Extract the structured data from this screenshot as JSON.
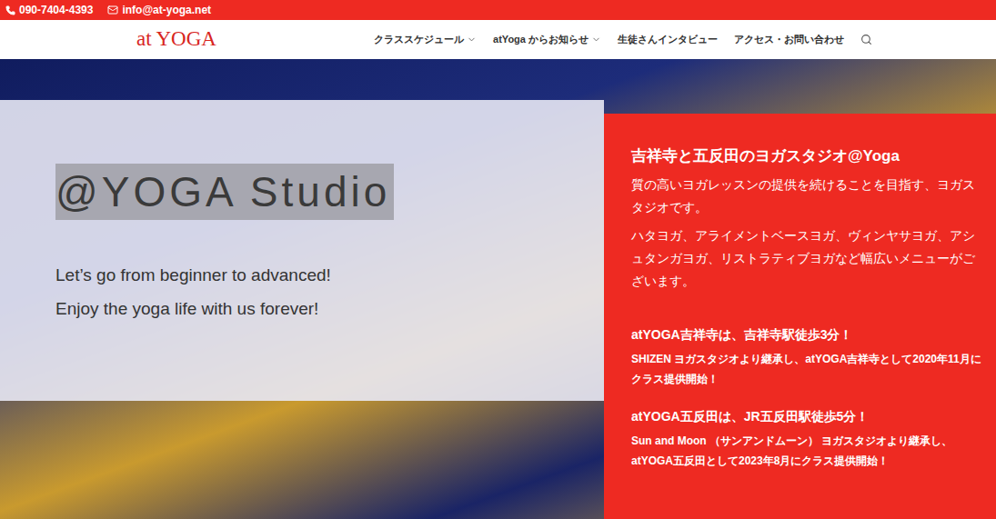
{
  "top_bar": {
    "phone": "090-7404-4393",
    "email": "info@at-yoga.net"
  },
  "header": {
    "logo": "at YOGA",
    "menu": [
      {
        "label": "クラススケジュール",
        "dropdown": true
      },
      {
        "label": "atYoga からお知らせ",
        "dropdown": true
      },
      {
        "label": "生徒さんインタビュー",
        "dropdown": false
      },
      {
        "label": "アクセス・お問い合わせ",
        "dropdown": false
      }
    ]
  },
  "hero": {
    "title": "@YOGA Studio",
    "lines": [
      "Let’s go from beginner to advanced!",
      "Enjoy the yoga life with us forever!"
    ]
  },
  "info_panel": {
    "heading": "吉祥寺と五反田のヨガスタジオ@Yoga",
    "paragraphs": [
      "質の高いヨガレッスンの提供を続けることを目指す、ヨガスタジオです。",
      "ハタヨガ、アライメントベースヨガ、ヴィンヤサヨガ、アシュタンガヨガ、リストラティブヨガなど幅広いメニューがございます。"
    ],
    "studios": [
      {
        "title": "atYOGA吉祥寺は、吉祥寺駅徒歩3分！",
        "detail": "SHIZEN ヨガスタジオより継承し、atYOGA吉祥寺として2020年11月にクラス提供開始！"
      },
      {
        "title": "atYOGA五反田は、JR五反田駅徒歩5分！",
        "detail": "Sun and Moon （サンアンドムーン） ヨガスタジオより継承し、atYOGA五反田として2023年8月にクラス提供開始！"
      }
    ]
  }
}
